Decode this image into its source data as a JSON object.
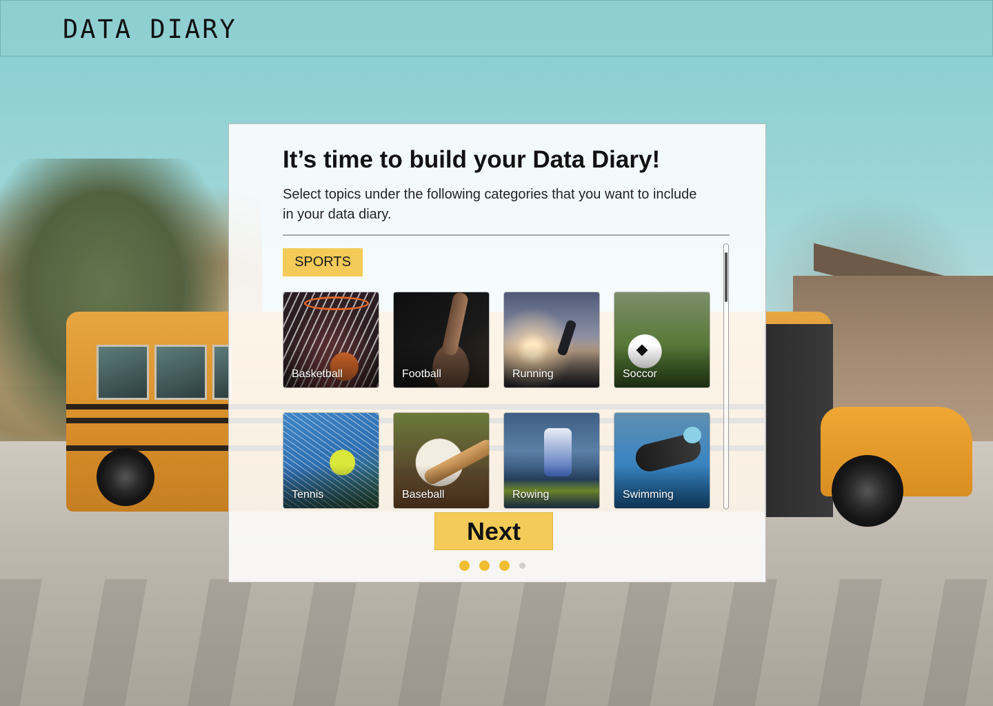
{
  "app": {
    "brand": "DATA DIARY"
  },
  "onboarding": {
    "title": "It’s time to build your Data Diary!",
    "subtitle": "Select topics under the following categories that you want to include in your data diary.",
    "category": "SPORTS",
    "topics": [
      {
        "label": "Basketball",
        "icon": "basketball-photo"
      },
      {
        "label": "Football",
        "icon": "football-photo"
      },
      {
        "label": "Running",
        "icon": "running-photo"
      },
      {
        "label": "Soccor",
        "icon": "soccer-photo"
      },
      {
        "label": "Tennis",
        "icon": "tennis-photo"
      },
      {
        "label": "Baseball",
        "icon": "baseball-photo"
      },
      {
        "label": "Rowing",
        "icon": "rowing-photo"
      },
      {
        "label": "Swimming",
        "icon": "swimming-photo"
      }
    ],
    "next_label": "Next",
    "progress": {
      "current_step": 3,
      "total_steps": 4
    }
  },
  "colors": {
    "accent": "#f4cb58",
    "dot_active": "#f0bd30",
    "dot_inactive": "#cfcfcf"
  }
}
